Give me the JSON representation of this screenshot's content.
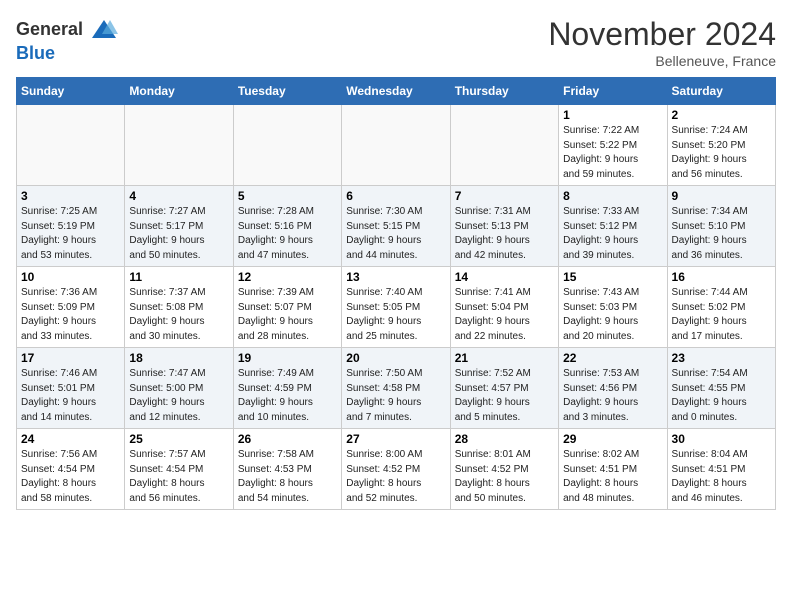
{
  "header": {
    "logo_line1": "General",
    "logo_line2": "Blue",
    "month_title": "November 2024",
    "location": "Belleneuve, France"
  },
  "weekdays": [
    "Sunday",
    "Monday",
    "Tuesday",
    "Wednesday",
    "Thursday",
    "Friday",
    "Saturday"
  ],
  "weeks": [
    [
      {
        "day": "",
        "info": ""
      },
      {
        "day": "",
        "info": ""
      },
      {
        "day": "",
        "info": ""
      },
      {
        "day": "",
        "info": ""
      },
      {
        "day": "",
        "info": ""
      },
      {
        "day": "1",
        "info": "Sunrise: 7:22 AM\nSunset: 5:22 PM\nDaylight: 9 hours\nand 59 minutes."
      },
      {
        "day": "2",
        "info": "Sunrise: 7:24 AM\nSunset: 5:20 PM\nDaylight: 9 hours\nand 56 minutes."
      }
    ],
    [
      {
        "day": "3",
        "info": "Sunrise: 7:25 AM\nSunset: 5:19 PM\nDaylight: 9 hours\nand 53 minutes."
      },
      {
        "day": "4",
        "info": "Sunrise: 7:27 AM\nSunset: 5:17 PM\nDaylight: 9 hours\nand 50 minutes."
      },
      {
        "day": "5",
        "info": "Sunrise: 7:28 AM\nSunset: 5:16 PM\nDaylight: 9 hours\nand 47 minutes."
      },
      {
        "day": "6",
        "info": "Sunrise: 7:30 AM\nSunset: 5:15 PM\nDaylight: 9 hours\nand 44 minutes."
      },
      {
        "day": "7",
        "info": "Sunrise: 7:31 AM\nSunset: 5:13 PM\nDaylight: 9 hours\nand 42 minutes."
      },
      {
        "day": "8",
        "info": "Sunrise: 7:33 AM\nSunset: 5:12 PM\nDaylight: 9 hours\nand 39 minutes."
      },
      {
        "day": "9",
        "info": "Sunrise: 7:34 AM\nSunset: 5:10 PM\nDaylight: 9 hours\nand 36 minutes."
      }
    ],
    [
      {
        "day": "10",
        "info": "Sunrise: 7:36 AM\nSunset: 5:09 PM\nDaylight: 9 hours\nand 33 minutes."
      },
      {
        "day": "11",
        "info": "Sunrise: 7:37 AM\nSunset: 5:08 PM\nDaylight: 9 hours\nand 30 minutes."
      },
      {
        "day": "12",
        "info": "Sunrise: 7:39 AM\nSunset: 5:07 PM\nDaylight: 9 hours\nand 28 minutes."
      },
      {
        "day": "13",
        "info": "Sunrise: 7:40 AM\nSunset: 5:05 PM\nDaylight: 9 hours\nand 25 minutes."
      },
      {
        "day": "14",
        "info": "Sunrise: 7:41 AM\nSunset: 5:04 PM\nDaylight: 9 hours\nand 22 minutes."
      },
      {
        "day": "15",
        "info": "Sunrise: 7:43 AM\nSunset: 5:03 PM\nDaylight: 9 hours\nand 20 minutes."
      },
      {
        "day": "16",
        "info": "Sunrise: 7:44 AM\nSunset: 5:02 PM\nDaylight: 9 hours\nand 17 minutes."
      }
    ],
    [
      {
        "day": "17",
        "info": "Sunrise: 7:46 AM\nSunset: 5:01 PM\nDaylight: 9 hours\nand 14 minutes."
      },
      {
        "day": "18",
        "info": "Sunrise: 7:47 AM\nSunset: 5:00 PM\nDaylight: 9 hours\nand 12 minutes."
      },
      {
        "day": "19",
        "info": "Sunrise: 7:49 AM\nSunset: 4:59 PM\nDaylight: 9 hours\nand 10 minutes."
      },
      {
        "day": "20",
        "info": "Sunrise: 7:50 AM\nSunset: 4:58 PM\nDaylight: 9 hours\nand 7 minutes."
      },
      {
        "day": "21",
        "info": "Sunrise: 7:52 AM\nSunset: 4:57 PM\nDaylight: 9 hours\nand 5 minutes."
      },
      {
        "day": "22",
        "info": "Sunrise: 7:53 AM\nSunset: 4:56 PM\nDaylight: 9 hours\nand 3 minutes."
      },
      {
        "day": "23",
        "info": "Sunrise: 7:54 AM\nSunset: 4:55 PM\nDaylight: 9 hours\nand 0 minutes."
      }
    ],
    [
      {
        "day": "24",
        "info": "Sunrise: 7:56 AM\nSunset: 4:54 PM\nDaylight: 8 hours\nand 58 minutes."
      },
      {
        "day": "25",
        "info": "Sunrise: 7:57 AM\nSunset: 4:54 PM\nDaylight: 8 hours\nand 56 minutes."
      },
      {
        "day": "26",
        "info": "Sunrise: 7:58 AM\nSunset: 4:53 PM\nDaylight: 8 hours\nand 54 minutes."
      },
      {
        "day": "27",
        "info": "Sunrise: 8:00 AM\nSunset: 4:52 PM\nDaylight: 8 hours\nand 52 minutes."
      },
      {
        "day": "28",
        "info": "Sunrise: 8:01 AM\nSunset: 4:52 PM\nDaylight: 8 hours\nand 50 minutes."
      },
      {
        "day": "29",
        "info": "Sunrise: 8:02 AM\nSunset: 4:51 PM\nDaylight: 8 hours\nand 48 minutes."
      },
      {
        "day": "30",
        "info": "Sunrise: 8:04 AM\nSunset: 4:51 PM\nDaylight: 8 hours\nand 46 minutes."
      }
    ]
  ]
}
